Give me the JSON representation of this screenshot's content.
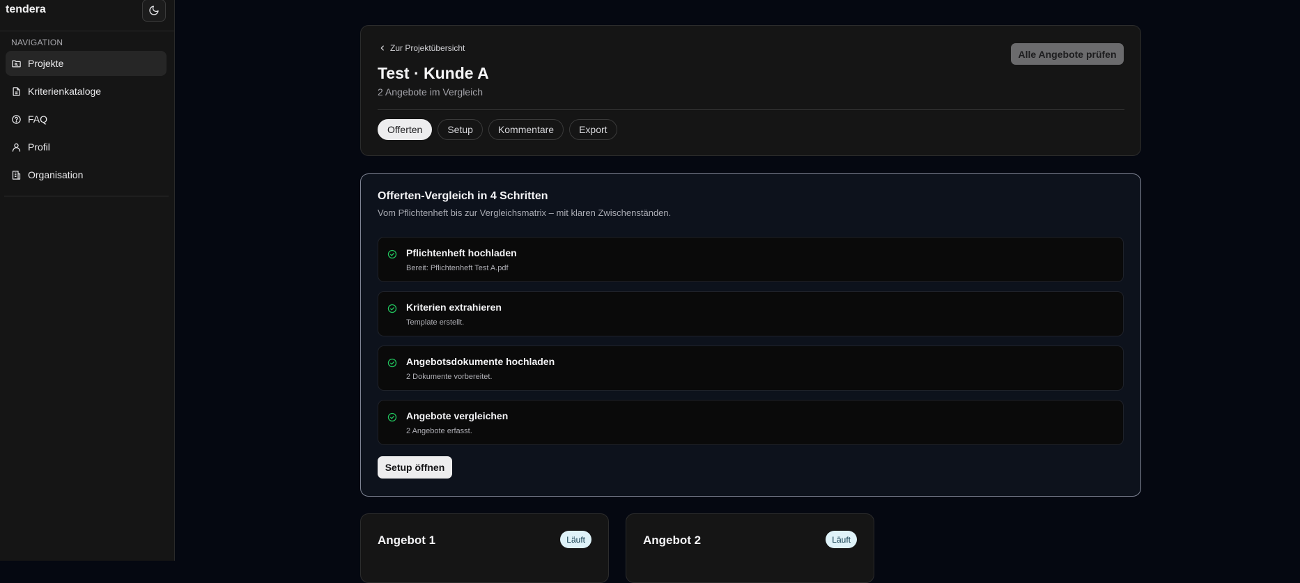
{
  "sidebar": {
    "brand": "tendera",
    "nav_heading": "NAVIGATION",
    "items": [
      {
        "label": "Projekte",
        "icon": "folder-icon",
        "active": true
      },
      {
        "label": "Kriterienkataloge",
        "icon": "document-icon",
        "active": false
      },
      {
        "label": "FAQ",
        "icon": "help-circle-icon",
        "active": false
      },
      {
        "label": "Profil",
        "icon": "user-icon",
        "active": false
      },
      {
        "label": "Organisation",
        "icon": "building-icon",
        "active": false
      }
    ],
    "theme_toggle_icon": "moon-icon"
  },
  "header": {
    "back_label": "Zur Projektübersicht",
    "title": "Test · Kunde A",
    "subtitle": "2 Angebote im Vergleich",
    "check_all_label": "Alle Angebote prüfen",
    "tabs": [
      {
        "label": "Offerten",
        "active": true
      },
      {
        "label": "Setup",
        "active": false
      },
      {
        "label": "Kommentare",
        "active": false
      },
      {
        "label": "Export",
        "active": false
      }
    ]
  },
  "steps": {
    "title": "Offerten-Vergleich in 4 Schritten",
    "subtitle": "Vom Pflichtenheft bis zur Vergleichsmatrix – mit klaren Zwischenständen.",
    "items": [
      {
        "title": "Pflichtenheft hochladen",
        "desc": "Bereit: Pflichtenheft Test A.pdf",
        "done": true
      },
      {
        "title": "Kriterien extrahieren",
        "desc": "Template erstellt.",
        "done": true
      },
      {
        "title": "Angebotsdokumente hochladen",
        "desc": "2 Dokumente vorbereitet.",
        "done": true
      },
      {
        "title": "Angebote vergleichen",
        "desc": "2 Angebote erfasst.",
        "done": true
      }
    ],
    "setup_button_label": "Setup öffnen"
  },
  "offers": [
    {
      "title": "Angebot 1",
      "status": "Läuft"
    },
    {
      "title": "Angebot 2",
      "status": "Läuft"
    }
  ],
  "colors": {
    "background": "#050811",
    "sidebar": "#151515",
    "success": "#22c55e",
    "badge_bg": "#dff3f9"
  }
}
